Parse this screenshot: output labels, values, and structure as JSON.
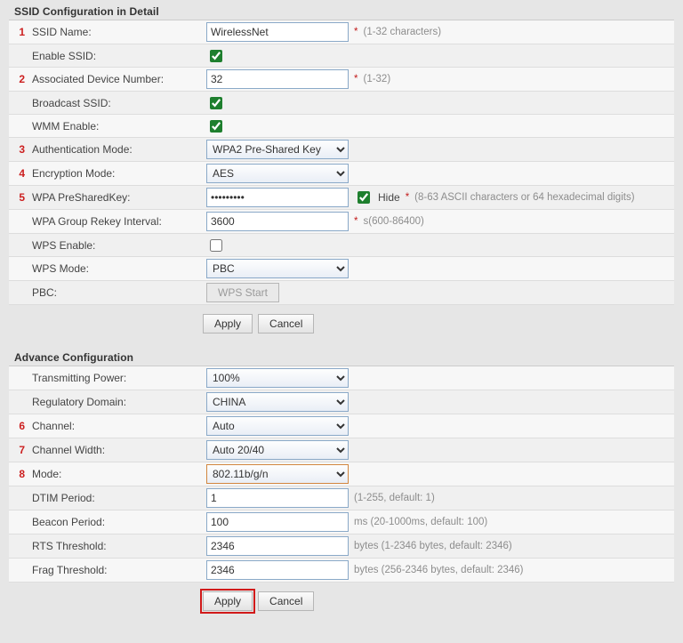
{
  "ssid": {
    "title": "SSID Configuration in Detail",
    "rows": {
      "ssid_name": {
        "num": "1",
        "label": "SSID Name:",
        "value": "WirelessNet",
        "hint": "(1-32 characters)",
        "ast": "* "
      },
      "enable_ssid": {
        "label": "Enable SSID:",
        "checked": true
      },
      "assoc_dev": {
        "num": "2",
        "label": "Associated Device Number:",
        "value": "32",
        "hint": "(1-32)",
        "ast": "* "
      },
      "broadcast": {
        "label": "Broadcast SSID:",
        "checked": true
      },
      "wmm": {
        "label": "WMM Enable:",
        "checked": true
      },
      "auth_mode": {
        "num": "3",
        "label": "Authentication Mode:",
        "value": "WPA2 Pre-Shared Key"
      },
      "enc_mode": {
        "num": "4",
        "label": "Encryption Mode:",
        "value": "AES"
      },
      "psk": {
        "num": "5",
        "label": "WPA PreSharedKey:",
        "value": "•••••••••",
        "hide_label": "Hide ",
        "hide_checked": true,
        "hint": "(8-63 ASCII characters or 64 hexadecimal digits)",
        "ast": "*"
      },
      "rekey": {
        "label": "WPA Group Rekey Interval:",
        "value": "3600",
        "hint": "s(600-86400)",
        "ast": "*"
      },
      "wps_enable": {
        "label": "WPS Enable:",
        "checked": false
      },
      "wps_mode": {
        "label": "WPS Mode:",
        "value": "PBC"
      },
      "pbc": {
        "label": "PBC:",
        "button": "WPS Start"
      }
    },
    "actions": {
      "apply": "Apply",
      "cancel": "Cancel"
    }
  },
  "adv": {
    "title": "Advance Configuration",
    "rows": {
      "tx_power": {
        "label": "Transmitting Power:",
        "value": "100%"
      },
      "reg_domain": {
        "label": "Regulatory Domain:",
        "value": "CHINA"
      },
      "channel": {
        "num": "6",
        "label": "Channel:",
        "value": "Auto"
      },
      "ch_width": {
        "num": "7",
        "label": "Channel Width:",
        "value": "Auto 20/40"
      },
      "mode": {
        "num": "8",
        "label": "Mode:",
        "value": "802.11b/g/n"
      },
      "dtim": {
        "label": "DTIM Period:",
        "value": "1",
        "hint": "(1-255, default: 1)"
      },
      "beacon": {
        "label": "Beacon Period:",
        "value": "100",
        "hint": "ms (20-1000ms, default: 100)"
      },
      "rts": {
        "label": "RTS Threshold:",
        "value": "2346",
        "hint": "bytes (1-2346 bytes, default: 2346)"
      },
      "frag": {
        "label": "Frag Threshold:",
        "value": "2346",
        "hint": "bytes (256-2346 bytes, default: 2346)"
      }
    },
    "actions": {
      "apply": "Apply",
      "cancel": "Cancel"
    }
  }
}
